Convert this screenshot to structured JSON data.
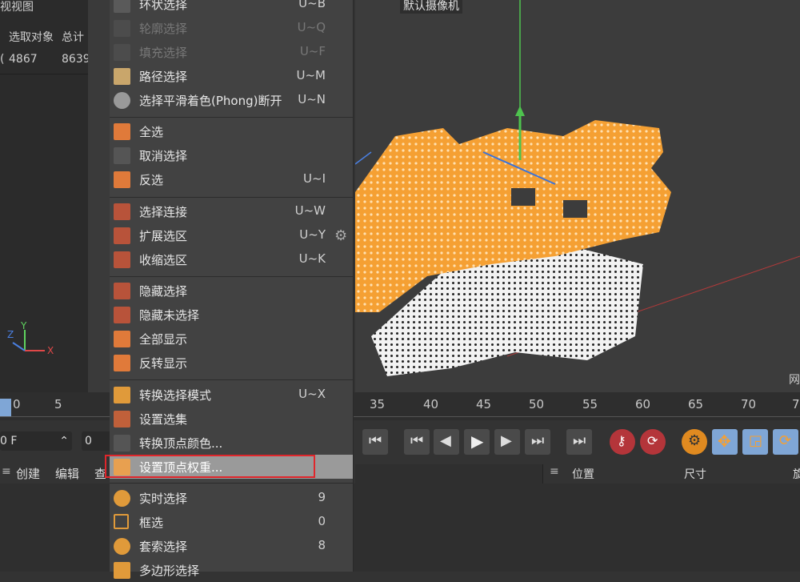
{
  "left_panel": {
    "title": "视视图",
    "col1": "选取对象",
    "col2": "总计",
    "val_prefix": "(",
    "val1": "4867",
    "val2": "8639",
    "axis_y": "Y",
    "axis_z": "Z",
    "axis_x": "X"
  },
  "viewport": {
    "camera_label": "默认摄像机",
    "corner_label": "网"
  },
  "menu": {
    "items": [
      {
        "label": "环状选择",
        "shortcut": "U~B",
        "icon": "loop-select-icon"
      },
      {
        "label": "轮廓选择",
        "shortcut": "U~Q",
        "icon": "outline-select-icon"
      },
      {
        "label": "填充选择",
        "shortcut": "U~F",
        "icon": "fill-select-icon"
      },
      {
        "label": "路径选择",
        "shortcut": "U~M",
        "icon": "path-select-icon"
      },
      {
        "label": "选择平滑着色(Phong)断开",
        "shortcut": "U~N",
        "icon": "phong-break-icon"
      },
      {
        "label": "全选",
        "shortcut": "",
        "icon": "select-all-icon"
      },
      {
        "label": "取消选择",
        "shortcut": "",
        "icon": "deselect-icon"
      },
      {
        "label": "反选",
        "shortcut": "U~I",
        "icon": "invert-select-icon"
      },
      {
        "label": "选择连接",
        "shortcut": "U~W",
        "icon": "select-connected-icon"
      },
      {
        "label": "扩展选区",
        "shortcut": "U~Y",
        "icon": "grow-select-icon"
      },
      {
        "label": "收缩选区",
        "shortcut": "U~K",
        "icon": "shrink-select-icon"
      },
      {
        "label": "隐藏选择",
        "shortcut": "",
        "icon": "hide-selected-icon"
      },
      {
        "label": "隐藏未选择",
        "shortcut": "",
        "icon": "hide-unselected-icon"
      },
      {
        "label": "全部显示",
        "shortcut": "",
        "icon": "unhide-all-icon"
      },
      {
        "label": "反转显示",
        "shortcut": "",
        "icon": "invert-visibility-icon"
      },
      {
        "label": "转换选择模式",
        "shortcut": "U~X",
        "icon": "convert-selection-icon"
      },
      {
        "label": "设置选集",
        "shortcut": "",
        "icon": "set-selection-icon"
      },
      {
        "label": "转换顶点颜色...",
        "shortcut": "",
        "icon": "convert-vertex-color-icon"
      },
      {
        "label": "设置顶点权重...",
        "shortcut": "",
        "icon": "set-vertex-weight-icon"
      },
      {
        "label": "实时选择",
        "shortcut": "9",
        "icon": "live-select-icon"
      },
      {
        "label": "框选",
        "shortcut": "0",
        "icon": "rect-select-icon"
      },
      {
        "label": "套索选择",
        "shortcut": "8",
        "icon": "lasso-select-icon"
      },
      {
        "label": "多边形选择",
        "shortcut": "",
        "icon": "polygon-select-icon"
      }
    ]
  },
  "timeline": {
    "left_ticks": [
      "0",
      "5"
    ],
    "right_ticks": [
      "35",
      "40",
      "45",
      "50",
      "55",
      "60",
      "65",
      "70",
      "7"
    ]
  },
  "transport": {
    "frame_field": "0 F",
    "frame_field2": "0"
  },
  "bottom_bar": {
    "create": "创建",
    "edit": "编辑",
    "view": "查",
    "position": "位置",
    "size": "尺寸",
    "rotation": "旋"
  },
  "colors": {
    "accent_orange": "#f5a033",
    "menu_bg": "#424242",
    "highlight_border": "#e0262b"
  }
}
